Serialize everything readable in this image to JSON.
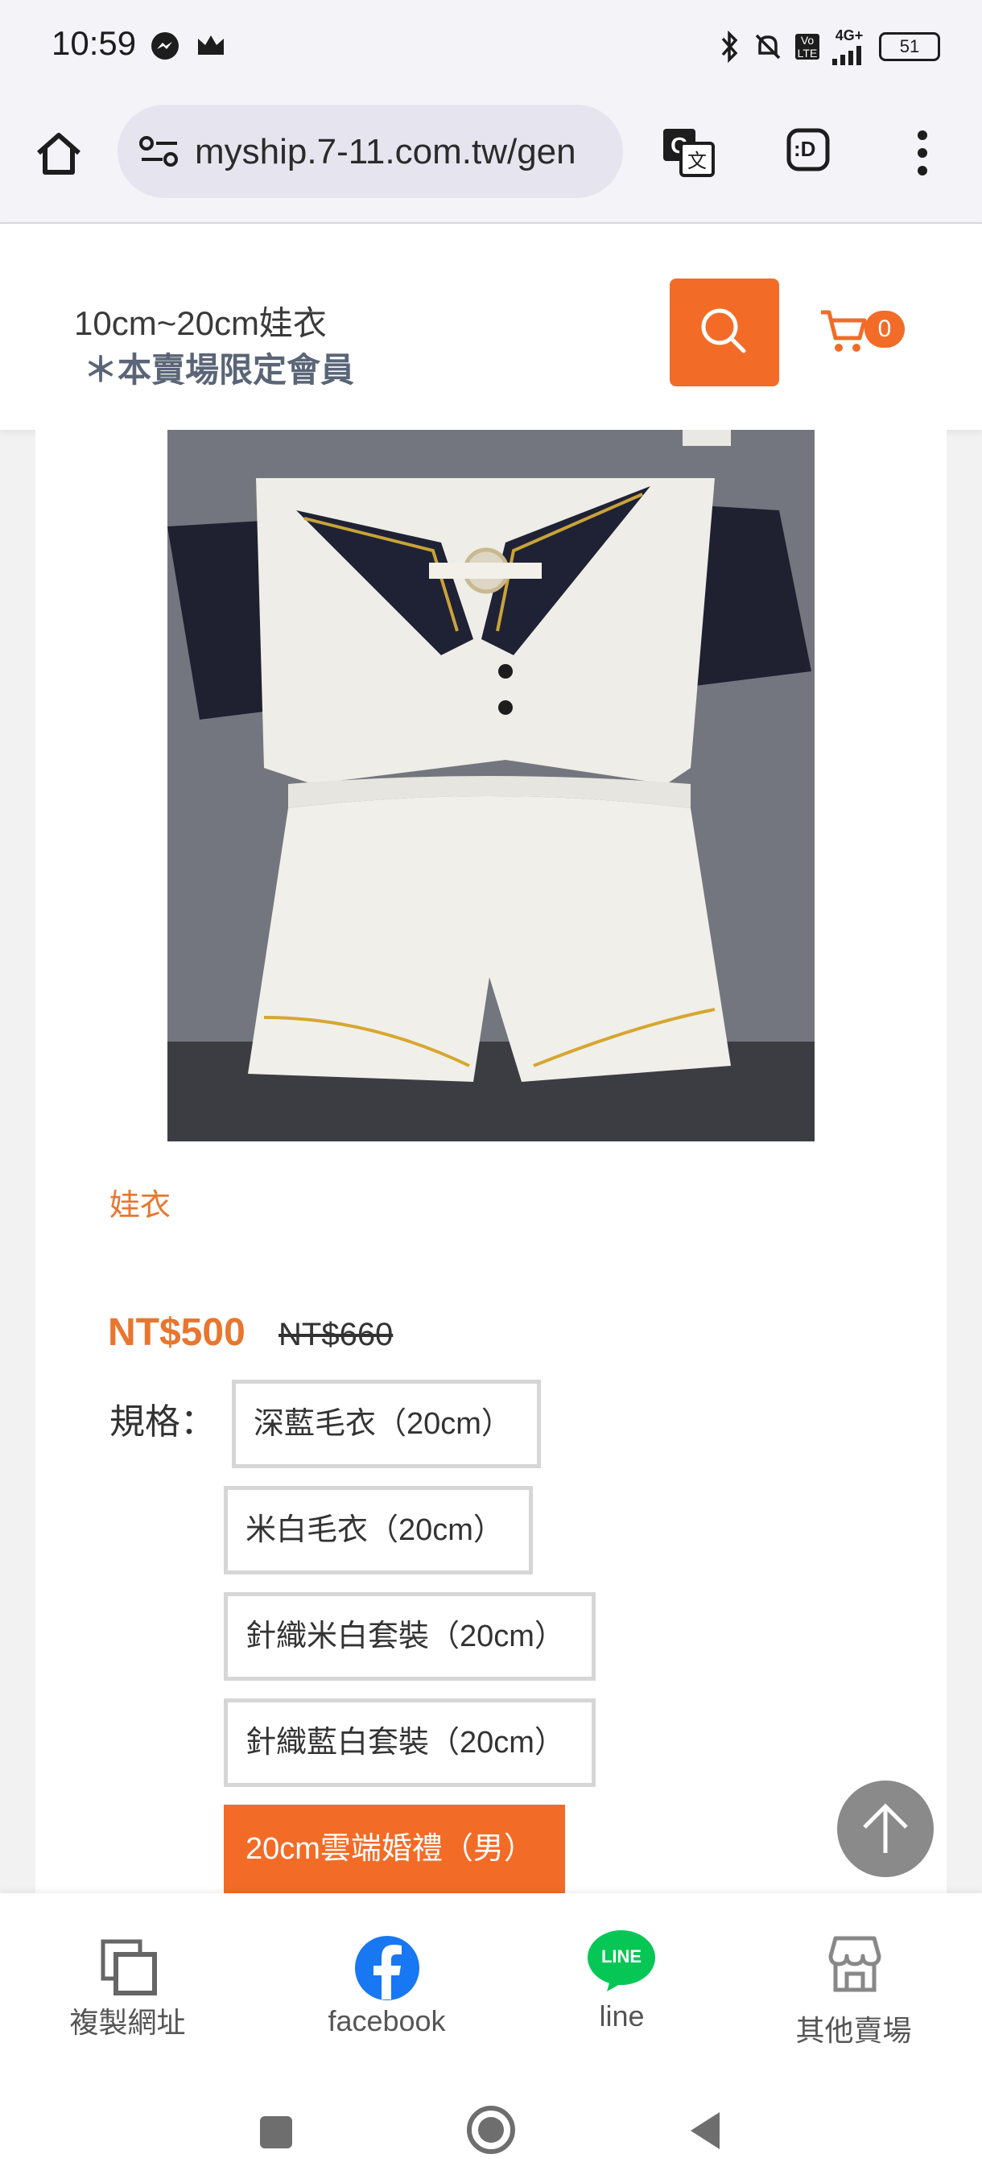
{
  "status_bar": {
    "time": "10:59",
    "battery": "51",
    "network": "4G+",
    "volte": "Vo LTE"
  },
  "browser": {
    "url": "myship.7-11.com.tw/gen",
    "translate_icon": "translate-icon",
    "extension_label": ":D"
  },
  "header": {
    "title": "10cm~20cm娃衣",
    "subtitle": "＊本賣場限定會員",
    "cart_count": "0"
  },
  "product": {
    "category": "娃衣",
    "price": "NT$500",
    "original_price": "NT$660",
    "spec_label": "規格：",
    "options": [
      {
        "label": "深藍毛衣（20cm）",
        "selected": false
      },
      {
        "label": "米白毛衣（20cm）",
        "selected": false
      },
      {
        "label": "針織米白套裝（20cm）",
        "selected": false
      },
      {
        "label": "針織藍白套裝（20cm）",
        "selected": false
      },
      {
        "label": "20cm雲端婚禮（男）",
        "selected": true
      }
    ]
  },
  "bottom_bar": {
    "items": [
      {
        "label": "複製網址",
        "icon": "copy-icon"
      },
      {
        "label": "facebook",
        "icon": "facebook-icon"
      },
      {
        "label": "line",
        "icon": "line-icon"
      },
      {
        "label": "其他賣場",
        "icon": "store-icon"
      }
    ],
    "line_badge": "LINE"
  },
  "colors": {
    "accent": "#f26c28",
    "price": "#e8762f",
    "facebook": "#1877f2",
    "line": "#06c755"
  }
}
